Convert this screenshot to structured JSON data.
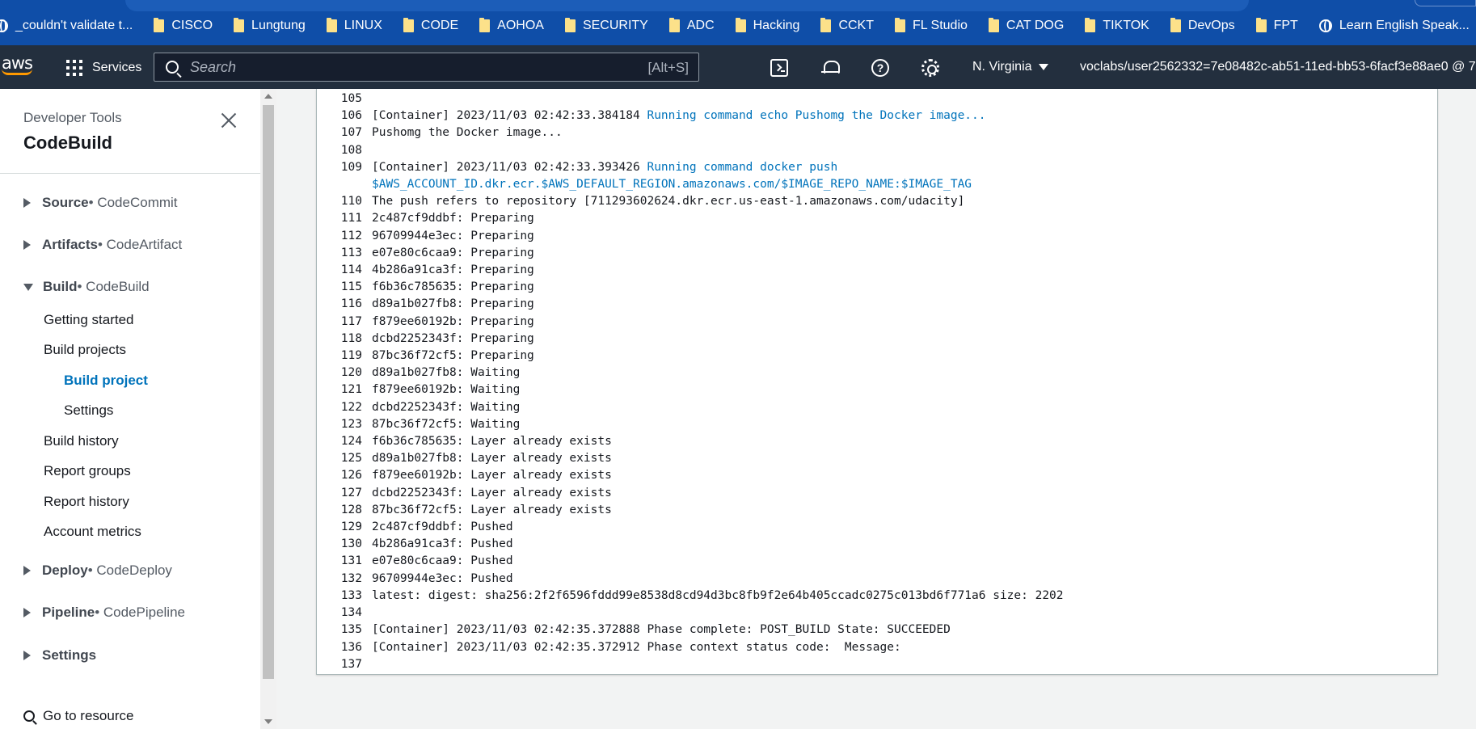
{
  "bookmarks": {
    "first": "_couldn't validate t...",
    "folders": [
      "CISCO",
      "Lungtung",
      "LINUX",
      "CODE",
      "AOHOA",
      "SECURITY",
      "ADC",
      "Hacking",
      "CCKT",
      "FL Studio",
      "CAT DOG",
      "TIKTOK",
      "DevOps",
      "FPT"
    ],
    "last": "Learn English Speak..."
  },
  "nav": {
    "logo": "aws",
    "services_label": "Services",
    "search_placeholder": "Search",
    "search_hint": "[Alt+S]",
    "help_glyph": "?",
    "region": "N. Virginia",
    "account": "voclabs/user2562332=7e08482c-ab51-11ed-bb53-6facf3e88ae0 @ 71"
  },
  "sidebar": {
    "subtitle": "Developer Tools",
    "title": "CodeBuild",
    "source": {
      "bold": "Source",
      "service": " • CodeCommit"
    },
    "artifacts": {
      "bold": "Artifacts",
      "service": " • CodeArtifact"
    },
    "build": {
      "bold": "Build",
      "service": " • CodeBuild"
    },
    "build_items": [
      "Getting started",
      "Build projects",
      "Build project",
      "Settings",
      "Build history",
      "Report groups",
      "Report history",
      "Account metrics"
    ],
    "deploy": {
      "bold": "Deploy",
      "service": " • CodeDeploy"
    },
    "pipeline": {
      "bold": "Pipeline",
      "service": " • CodePipeline"
    },
    "settings": {
      "bold": "Settings"
    },
    "goto": "Go to resource"
  },
  "log": {
    "lines": [
      {
        "n": "105",
        "t": "",
        "cmd": ""
      },
      {
        "n": "106",
        "t": "[Container] 2023/11/03 02:42:33.384184 ",
        "cmd": "Running command echo Pushomg the Docker image..."
      },
      {
        "n": "107",
        "t": "Pushomg the Docker image...",
        "cmd": ""
      },
      {
        "n": "108",
        "t": "",
        "cmd": ""
      },
      {
        "n": "109",
        "t": "[Container] 2023/11/03 02:42:33.393426 ",
        "cmd": "Running command docker push"
      },
      {
        "n": "",
        "t": "",
        "cmd": "",
        "cont": "$AWS_ACCOUNT_ID.dkr.ecr.$AWS_DEFAULT_REGION.amazonaws.com/$IMAGE_REPO_NAME:$IMAGE_TAG"
      },
      {
        "n": "110",
        "t": "The push refers to repository [711293602624.dkr.ecr.us-east-1.amazonaws.com/udacity]",
        "cmd": ""
      },
      {
        "n": "111",
        "t": "2c487cf9ddbf: Preparing",
        "cmd": ""
      },
      {
        "n": "112",
        "t": "96709944e3ec: Preparing",
        "cmd": ""
      },
      {
        "n": "113",
        "t": "e07e80c6caa9: Preparing",
        "cmd": ""
      },
      {
        "n": "114",
        "t": "4b286a91ca3f: Preparing",
        "cmd": ""
      },
      {
        "n": "115",
        "t": "f6b36c785635: Preparing",
        "cmd": ""
      },
      {
        "n": "116",
        "t": "d89a1b027fb8: Preparing",
        "cmd": ""
      },
      {
        "n": "117",
        "t": "f879ee60192b: Preparing",
        "cmd": ""
      },
      {
        "n": "118",
        "t": "dcbd2252343f: Preparing",
        "cmd": ""
      },
      {
        "n": "119",
        "t": "87bc36f72cf5: Preparing",
        "cmd": ""
      },
      {
        "n": "120",
        "t": "d89a1b027fb8: Waiting",
        "cmd": ""
      },
      {
        "n": "121",
        "t": "f879ee60192b: Waiting",
        "cmd": ""
      },
      {
        "n": "122",
        "t": "dcbd2252343f: Waiting",
        "cmd": ""
      },
      {
        "n": "123",
        "t": "87bc36f72cf5: Waiting",
        "cmd": ""
      },
      {
        "n": "124",
        "t": "f6b36c785635: Layer already exists",
        "cmd": ""
      },
      {
        "n": "125",
        "t": "d89a1b027fb8: Layer already exists",
        "cmd": ""
      },
      {
        "n": "126",
        "t": "f879ee60192b: Layer already exists",
        "cmd": ""
      },
      {
        "n": "127",
        "t": "dcbd2252343f: Layer already exists",
        "cmd": ""
      },
      {
        "n": "128",
        "t": "87bc36f72cf5: Layer already exists",
        "cmd": ""
      },
      {
        "n": "129",
        "t": "2c487cf9ddbf: Pushed",
        "cmd": ""
      },
      {
        "n": "130",
        "t": "4b286a91ca3f: Pushed",
        "cmd": ""
      },
      {
        "n": "131",
        "t": "e07e80c6caa9: Pushed",
        "cmd": ""
      },
      {
        "n": "132",
        "t": "96709944e3ec: Pushed",
        "cmd": ""
      },
      {
        "n": "133",
        "t": "latest: digest: sha256:2f2f6596fddd99e8538d8cd94d3bc8fb9f2e64b405ccadc0275c013bd6f771a6 size: 2202",
        "cmd": ""
      },
      {
        "n": "134",
        "t": "",
        "cmd": ""
      },
      {
        "n": "135",
        "t": "[Container] 2023/11/03 02:42:35.372888 Phase complete: POST_BUILD State: SUCCEEDED",
        "cmd": ""
      },
      {
        "n": "136",
        "t": "[Container] 2023/11/03 02:42:35.372912 Phase context status code:  Message:",
        "cmd": ""
      },
      {
        "n": "137",
        "t": "",
        "cmd": ""
      }
    ]
  },
  "colors": {
    "bookmark_bar": "#0f4ea8",
    "aws_nav": "#232f3e",
    "accent": "#0073bb",
    "aws_orange": "#ff9900"
  }
}
